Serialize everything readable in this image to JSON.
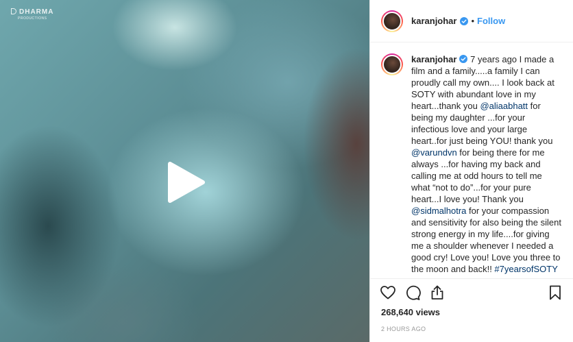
{
  "media": {
    "watermark": "DHARMA",
    "watermark_sub": "PRODUCTIONS",
    "play_icon": "play-icon"
  },
  "header": {
    "username": "karanjohar",
    "separator": "•",
    "follow_label": "Follow"
  },
  "caption": {
    "username": "karanjohar",
    "parts": [
      " 7 years ago I made a film and a family.....a family I can proudly call my own.... I look back at SOTY with abundant love in my heart...thank you ",
      "@aliaabhatt",
      " for being my daughter ...for your infectious love and your large heart..for just being YOU! thank you ",
      "@varundvn",
      " for being there for me always ...for having my back and calling me at odd hours to tell me what “not to do”...for your pure heart...I love you! Thank you ",
      "@sidmalhotra",
      " for your compassion and sensitivity for also being the silent strong energy in my life....for giving me a shoulder whenever I needed a good cry! Love you! Love you three to the moon and back!! ",
      "#7yearsofSOTY"
    ]
  },
  "stats": {
    "views": "268,640 views",
    "timestamp": "2 HOURS AGO"
  },
  "colors": {
    "accent": "#3897f0",
    "link": "#003569",
    "text": "#262626",
    "muted": "#999999"
  }
}
